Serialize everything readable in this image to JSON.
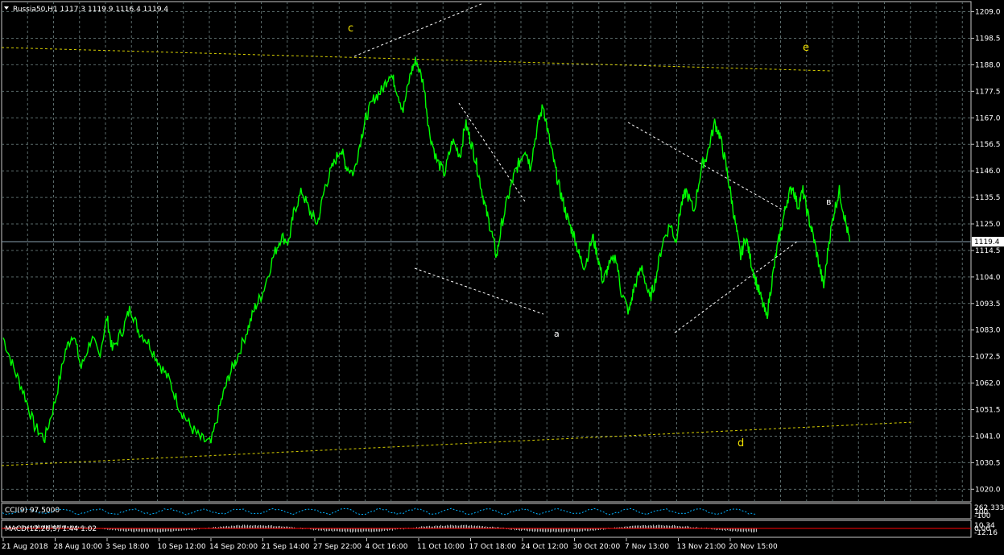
{
  "header": {
    "symbol_info": "Russia50,H1  1117.3 1119.9 1116.4 1119.4"
  },
  "price_axis": {
    "ticks": [
      "1209.0",
      "1198.5",
      "1188.0",
      "1177.5",
      "1167.0",
      "1156.5",
      "1146.0",
      "1135.5",
      "1125.0",
      "1114.5",
      "1104.0",
      "1093.5",
      "1083.0",
      "1072.5",
      "1062.0",
      "1051.5",
      "1041.0",
      "1030.5",
      "1020.0"
    ],
    "current_price": "1119.4"
  },
  "time_axis": {
    "ticks": [
      "21 Aug 2018",
      "28 Aug 10:00",
      "3 Sep 18:00",
      "10 Sep 12:00",
      "14 Sep 20:00",
      "21 Sep 14:00",
      "27 Sep 22:00",
      "4 Oct 16:00",
      "11 Oct 10:00",
      "17 Oct 18:00",
      "24 Oct 12:00",
      "30 Oct 20:00",
      "7 Nov 13:00",
      "13 Nov 21:00",
      "20 Nov 15:00"
    ]
  },
  "wave_labels": {
    "c": "c",
    "e": "e",
    "d": "d",
    "a": "a",
    "b": "в"
  },
  "indicators": {
    "cci": {
      "label": "CCI(9) 97.5000",
      "axis_values": [
        "262.3333",
        "100",
        "-100"
      ]
    },
    "macd": {
      "label": "MACD(12,26,9) 1.44 1.02",
      "axis_values": [
        "10.34",
        "0.00",
        "-12.16"
      ]
    }
  },
  "colors": {
    "background": "#000000",
    "price_line": "#00ff00",
    "grid": "#5a6a6a",
    "trendline_yellow": "#d8d000",
    "trendline_white": "#ffffff",
    "macd_hist": "#c0c0c0",
    "macd_signal": "#ff0000",
    "cci_line": "#00b0ff"
  },
  "chart_data": {
    "type": "line",
    "title": "Russia50,H1",
    "ylim": [
      1015,
      1213
    ],
    "x_categories": [
      "21 Aug 2018",
      "28 Aug 10:00",
      "3 Sep 18:00",
      "10 Sep 12:00",
      "14 Sep 20:00",
      "21 Sep 14:00",
      "27 Sep 22:00",
      "4 Oct 16:00",
      "11 Oct 10:00",
      "17 Oct 18:00",
      "24 Oct 12:00",
      "30 Oct 20:00",
      "7 Nov 13:00",
      "13 Nov 21:00",
      "20 Nov 15:00"
    ],
    "series": [
      {
        "name": "Russia50,H1",
        "points": [
          [
            0,
            1080
          ],
          [
            0.2,
            1068
          ],
          [
            0.4,
            1058
          ],
          [
            0.6,
            1045
          ],
          [
            0.8,
            1040
          ],
          [
            1.0,
            1055
          ],
          [
            1.2,
            1075
          ],
          [
            1.35,
            1082
          ],
          [
            1.5,
            1068
          ],
          [
            1.7,
            1080
          ],
          [
            1.85,
            1073
          ],
          [
            2.0,
            1088
          ],
          [
            2.1,
            1075
          ],
          [
            2.3,
            1083
          ],
          [
            2.45,
            1092
          ],
          [
            2.6,
            1083
          ],
          [
            2.8,
            1078
          ],
          [
            3.0,
            1070
          ],
          [
            3.2,
            1063
          ],
          [
            3.4,
            1052
          ],
          [
            3.6,
            1045
          ],
          [
            3.8,
            1040
          ],
          [
            4.0,
            1038
          ],
          [
            4.2,
            1055
          ],
          [
            4.35,
            1065
          ],
          [
            4.5,
            1072
          ],
          [
            4.7,
            1083
          ],
          [
            4.85,
            1092
          ],
          [
            5.0,
            1098
          ],
          [
            5.2,
            1112
          ],
          [
            5.35,
            1120
          ],
          [
            5.5,
            1118
          ],
          [
            5.6,
            1130
          ],
          [
            5.75,
            1138
          ],
          [
            5.9,
            1130
          ],
          [
            6.05,
            1125
          ],
          [
            6.2,
            1140
          ],
          [
            6.35,
            1148
          ],
          [
            6.5,
            1155
          ],
          [
            6.6,
            1148
          ],
          [
            6.75,
            1145
          ],
          [
            6.9,
            1160
          ],
          [
            7.0,
            1168
          ],
          [
            7.15,
            1175
          ],
          [
            7.3,
            1178
          ],
          [
            7.45,
            1185
          ],
          [
            7.55,
            1180
          ],
          [
            7.7,
            1170
          ],
          [
            7.85,
            1185
          ],
          [
            7.95,
            1190
          ],
          [
            8.1,
            1180
          ],
          [
            8.2,
            1162
          ],
          [
            8.35,
            1150
          ],
          [
            8.5,
            1145
          ],
          [
            8.65,
            1158
          ],
          [
            8.8,
            1152
          ],
          [
            8.9,
            1165
          ],
          [
            9.0,
            1158
          ],
          [
            9.1,
            1150
          ],
          [
            9.2,
            1140
          ],
          [
            9.3,
            1130
          ],
          [
            9.4,
            1122
          ],
          [
            9.5,
            1112
          ],
          [
            9.6,
            1125
          ],
          [
            9.75,
            1138
          ],
          [
            9.85,
            1145
          ],
          [
            9.95,
            1150
          ],
          [
            10.05,
            1155
          ],
          [
            10.15,
            1148
          ],
          [
            10.3,
            1165
          ],
          [
            10.4,
            1172
          ],
          [
            10.5,
            1160
          ],
          [
            10.6,
            1150
          ],
          [
            10.7,
            1140
          ],
          [
            10.8,
            1132
          ],
          [
            10.9,
            1125
          ],
          [
            11.0,
            1120
          ],
          [
            11.1,
            1112
          ],
          [
            11.2,
            1108
          ],
          [
            11.35,
            1120
          ],
          [
            11.45,
            1112
          ],
          [
            11.55,
            1102
          ],
          [
            11.65,
            1108
          ],
          [
            11.8,
            1112
          ],
          [
            11.9,
            1098
          ],
          [
            12.05,
            1090
          ],
          [
            12.15,
            1100
          ],
          [
            12.3,
            1108
          ],
          [
            12.45,
            1095
          ],
          [
            12.55,
            1102
          ],
          [
            12.7,
            1118
          ],
          [
            12.85,
            1125
          ],
          [
            12.95,
            1118
          ],
          [
            13.05,
            1132
          ],
          [
            13.15,
            1138
          ],
          [
            13.3,
            1130
          ],
          [
            13.45,
            1148
          ],
          [
            13.55,
            1152
          ],
          [
            13.7,
            1165
          ],
          [
            13.8,
            1160
          ],
          [
            13.9,
            1150
          ],
          [
            14.0,
            1138
          ],
          [
            14.1,
            1125
          ],
          [
            14.2,
            1112
          ],
          [
            14.3,
            1120
          ],
          [
            14.4,
            1110
          ],
          [
            14.5,
            1102
          ],
          [
            14.6,
            1095
          ],
          [
            14.7,
            1088
          ],
          [
            14.8,
            1102
          ],
          [
            14.9,
            1115
          ],
          [
            15.0,
            1125
          ],
          [
            15.1,
            1135
          ],
          [
            15.2,
            1140
          ],
          [
            15.3,
            1132
          ],
          [
            15.4,
            1138
          ],
          [
            15.5,
            1128
          ],
          [
            15.6,
            1120
          ],
          [
            15.7,
            1110
          ],
          [
            15.8,
            1100
          ],
          [
            15.9,
            1118
          ],
          [
            16.0,
            1130
          ],
          [
            16.1,
            1138
          ],
          [
            16.2,
            1128
          ],
          [
            16.3,
            1118
          ]
        ]
      }
    ]
  }
}
